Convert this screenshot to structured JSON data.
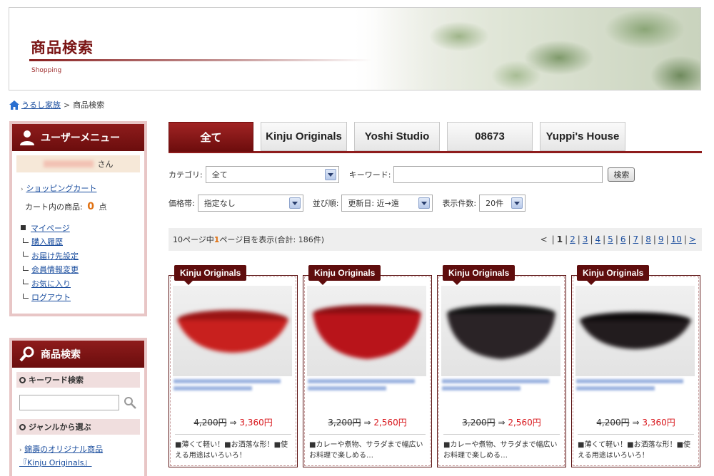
{
  "header": {
    "title": "商品検索",
    "subtitle": "Shopping"
  },
  "breadcrumb": {
    "home": "うるし家族",
    "separator": ">",
    "current": "商品検索"
  },
  "user_menu": {
    "title": "ユーザーメニュー",
    "name_suffix": "さん",
    "cart_link": "ショッピングカート",
    "cart_label": "カート内の商品:",
    "cart_count": "0",
    "cart_unit": "点",
    "items": [
      "マイページ",
      "購入履歴",
      "お届け先設定",
      "会員情報変更",
      "お気に入り",
      "ログアウト"
    ]
  },
  "side_search": {
    "title": "商品検索",
    "keyword_section": "キーワード検索",
    "genre_section": "ジャンルから選ぶ",
    "genre_link_line1": "錦壽のオリジナル商品",
    "genre_link_line2": "『Kinju Originals』"
  },
  "tabs": [
    "全て",
    "Kinju Originals",
    "Yoshi Studio",
    "08673",
    "Yuppi's House"
  ],
  "filters": {
    "category_label": "カテゴリ:",
    "category_value": "全て",
    "keyword_label": "キーワード:",
    "keyword_value": "",
    "search_button": "検索",
    "price_label": "価格帯:",
    "price_value": "指定なし",
    "sort_label": "並び順:",
    "sort_value": "更新日: 近→遠",
    "per_page_label": "表示件数:",
    "per_page_value": "20件"
  },
  "pager": {
    "summary_prefix": "10ページ中",
    "current": "1",
    "summary_suffix": "ページ目を表示(合計: 186件)",
    "prev": "<",
    "pages": [
      "2",
      "3",
      "4",
      "5",
      "6",
      "7",
      "8",
      "9",
      "10"
    ],
    "next": ">"
  },
  "products": [
    {
      "brand": "Kinju Originals",
      "old_price": "4,200円",
      "arrow": "⇒",
      "new_price": "3,360円",
      "desc": "■薄くて軽い！■お洒落な形！■使える用途はいろいろ！",
      "bowl_color": "#c8201e"
    },
    {
      "brand": "Kinju Originals",
      "old_price": "3,200円",
      "arrow": "⇒",
      "new_price": "2,560円",
      "desc": "■カレーや煮物、サラダまで幅広いお料理で楽しめる…",
      "bowl_color": "#b8141a"
    },
    {
      "brand": "Kinju Originals",
      "old_price": "3,200円",
      "arrow": "⇒",
      "new_price": "2,560円",
      "desc": "■カレーや煮物、サラダまで幅広いお料理で楽しめる…",
      "bowl_color": "#2a2326"
    },
    {
      "brand": "Kinju Originals",
      "old_price": "4,200円",
      "arrow": "⇒",
      "new_price": "3,360円",
      "desc": "■薄くて軽い！■お洒落な形！■使える用途はいろいろ！",
      "bowl_color": "#221c1e"
    }
  ]
}
